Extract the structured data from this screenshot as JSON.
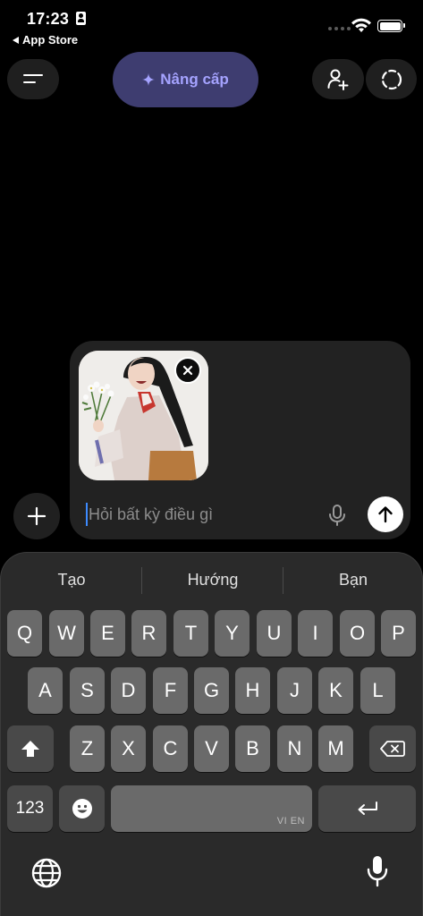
{
  "status_bar": {
    "time": "17:23",
    "back_app": "App Store"
  },
  "top_bar": {
    "upgrade_label": "Nâng cấp",
    "upgrade_icon": "sparkle-icon"
  },
  "composer": {
    "placeholder": "Hỏi bất kỳ điều gì",
    "attachment": "photo-thumbnail"
  },
  "keyboard": {
    "suggestions": [
      "Tạo",
      "Hướng",
      "Bạn"
    ],
    "row1": [
      "Q",
      "W",
      "E",
      "R",
      "T",
      "Y",
      "U",
      "I",
      "O",
      "P"
    ],
    "row2": [
      "A",
      "S",
      "D",
      "F",
      "G",
      "H",
      "J",
      "K",
      "L"
    ],
    "row3": [
      "Z",
      "X",
      "C",
      "V",
      "B",
      "N",
      "M"
    ],
    "numbers_label": "123",
    "space_sub": "VI EN"
  },
  "colors": {
    "upgrade_bg": "#3e3d70",
    "upgrade_text": "#a5a3ff",
    "caret": "#3d8bff"
  }
}
